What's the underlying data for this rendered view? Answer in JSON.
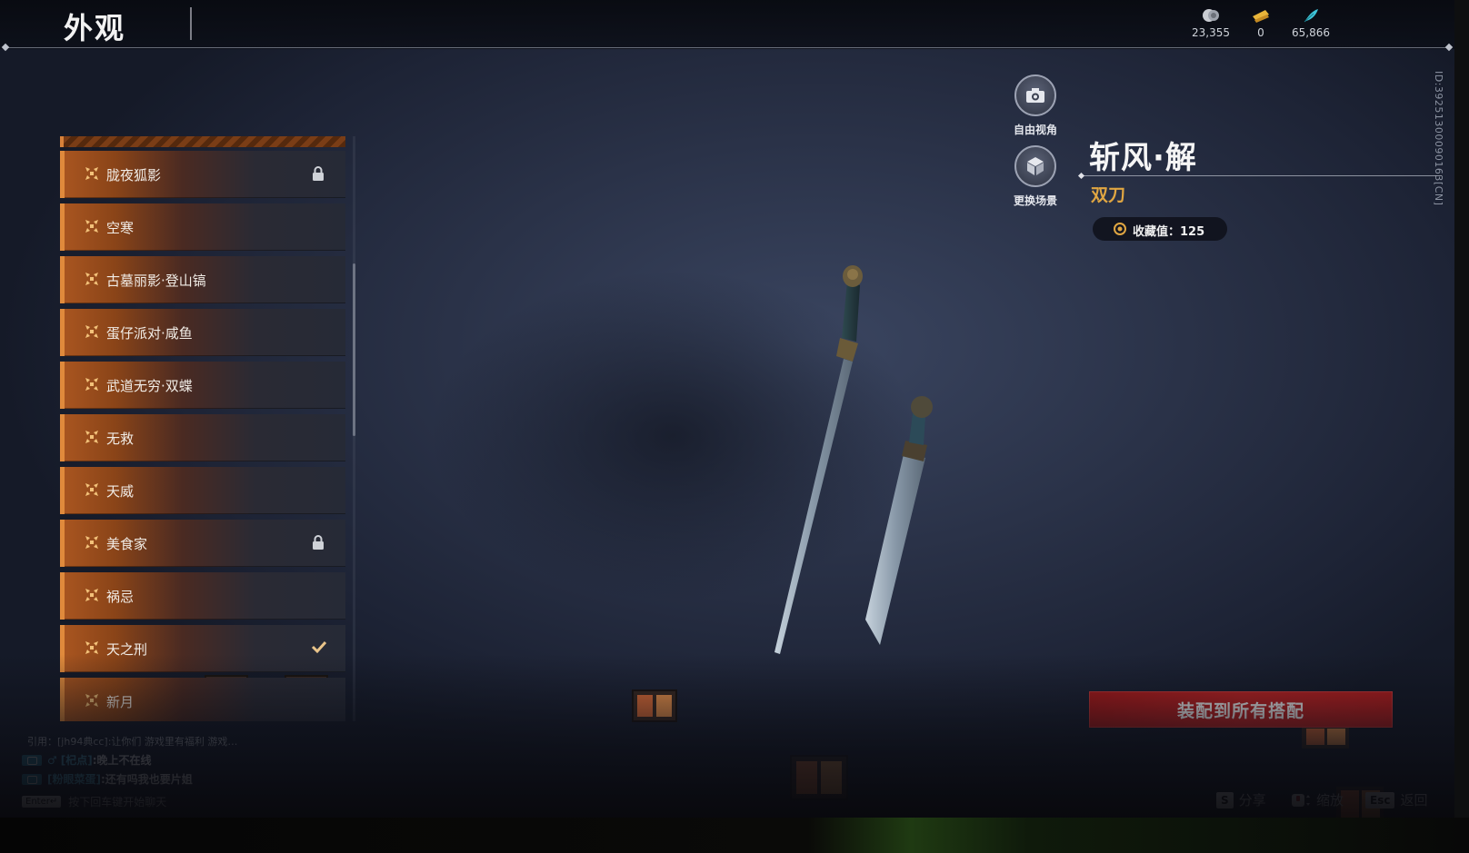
{
  "header": {
    "title": "外观",
    "currencies": [
      {
        "icon": "coin-icon",
        "value": "23,355"
      },
      {
        "icon": "ticket-icon",
        "value": "0"
      },
      {
        "icon": "feather-icon",
        "value": "65,866"
      }
    ],
    "player_id": "ID:39251300090163[CN]"
  },
  "list": {
    "items": [
      {
        "label": "胧夜狐影",
        "state": "locked"
      },
      {
        "label": "空寒",
        "state": "none"
      },
      {
        "label": "古墓丽影·登山镐",
        "state": "none"
      },
      {
        "label": "蛋仔派对·咸鱼",
        "state": "none"
      },
      {
        "label": "武道无穷·双蝶",
        "state": "none"
      },
      {
        "label": "无救",
        "state": "none"
      },
      {
        "label": "天威",
        "state": "none"
      },
      {
        "label": "美食家",
        "state": "locked"
      },
      {
        "label": "祸忌",
        "state": "none"
      },
      {
        "label": "天之刑",
        "state": "equipped"
      },
      {
        "label": "新月",
        "state": "none"
      }
    ]
  },
  "view_controls": {
    "free_camera": "自由视角",
    "change_scene": "更换场景"
  },
  "detail": {
    "name": "斩风·解",
    "type": "双刀",
    "collection_value": "收藏值：125"
  },
  "actions": {
    "equip_all": "装配到所有搭配"
  },
  "hotkeys": [
    {
      "key": "S",
      "label": "分享"
    },
    {
      "key": "",
      "label": "缩放"
    },
    {
      "key": "Esc",
      "label": "返回"
    }
  ],
  "chat": {
    "quote": "引用：[jh94典cc]:让你们 游戏里有福利 游戏…",
    "messages": [
      {
        "name": "[杞点]",
        "text": ":晚上不在线"
      },
      {
        "name": "[粉眼菜蛋]",
        "text": ":还有吗我也要片姐"
      }
    ],
    "enter_key": "Enter↵",
    "enter_hint": "按下回车键开始聊天"
  },
  "colors": {
    "accent_orange": "#e08a3c",
    "equip_red": "#c42424",
    "type_gold": "#e0a642",
    "chat_name": "#5bc8ef"
  }
}
